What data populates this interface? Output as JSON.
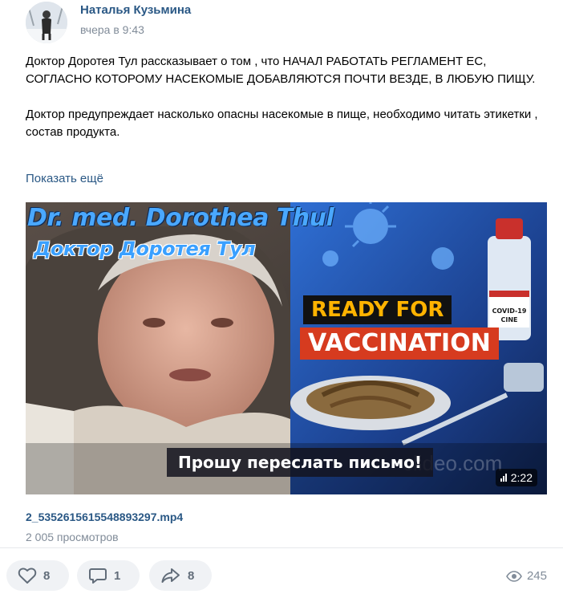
{
  "post": {
    "author": "Наталья Кузьмина",
    "time": "вчера в 9:43",
    "paragraph1": "Доктор Доротея Тул рассказывает о том , что НАЧАЛ РАБОТАТЬ РЕГЛАМЕНТ ЕС, СОГЛАСНО КОТОРОМУ НАСЕКОМЫЕ ДОБАВЛЯЮТСЯ ПОЧТИ ВЕЗДЕ, В ЛЮБУЮ ПИЩУ.",
    "paragraph2": "Доктор предупреждает насколько опасны насекомые в пище, необходимо читать этикетки , состав продукта.",
    "show_more": "Показать ещё"
  },
  "video": {
    "title_en": "Dr. med. Dorothea Thul",
    "title_ru": "Доктор Доротея Тул",
    "ready": "READY FOR",
    "vaccination": "VACCINATION",
    "vial_label_1": "COVID-19",
    "vial_label_2": "CINE",
    "subtitle": "Прошу переслать письмо!",
    "watermark": "clideo.com",
    "duration": "2:22",
    "file_name": "2_5352615615548893297.mp4",
    "views": "2 005 просмотров"
  },
  "actions": {
    "likes": "8",
    "comments": "1",
    "shares": "8",
    "views_total": "245"
  },
  "colors": {
    "link": "#2a5885",
    "muted": "#818c99",
    "button_bg": "#f0f2f5",
    "accent_orange": "#ffb300",
    "accent_red": "#d63b1f"
  }
}
